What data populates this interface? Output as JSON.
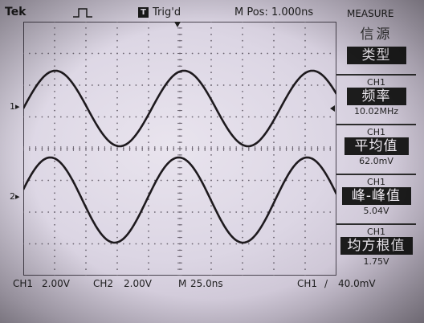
{
  "header": {
    "brand": "Tek",
    "trigger_status": "Trig'd",
    "trigger_icon_glyph": "T",
    "m_position": "M Pos: 1.000ns",
    "menu_title": "MEASURE"
  },
  "channel_markers": {
    "ch1": "1",
    "ch2": "2"
  },
  "side_panel": {
    "source": "信源",
    "type": "类型",
    "measurements": [
      {
        "channel": "CH1",
        "name": "频率",
        "value": "10.02MHz"
      },
      {
        "channel": "CH1",
        "name": "平均值",
        "value": "62.0mV"
      },
      {
        "channel": "CH1",
        "name": "峰-峰值",
        "value": "5.04V"
      },
      {
        "channel": "CH1",
        "name": "均方根值",
        "value": "1.75V"
      }
    ]
  },
  "footer": {
    "ch1_label": "CH1",
    "ch1_scale": "2.00V",
    "ch2_label": "CH2",
    "ch2_scale": "2.00V",
    "timebase_label": "M",
    "timebase_value": "25.0ns",
    "trigger_source": "CH1",
    "trigger_slope_glyph": "/",
    "trigger_level": "40.0mV"
  },
  "colors": {
    "trace": "#1e1a1e",
    "graticule": "#6b6470",
    "screen": "#e2dce8"
  }
}
